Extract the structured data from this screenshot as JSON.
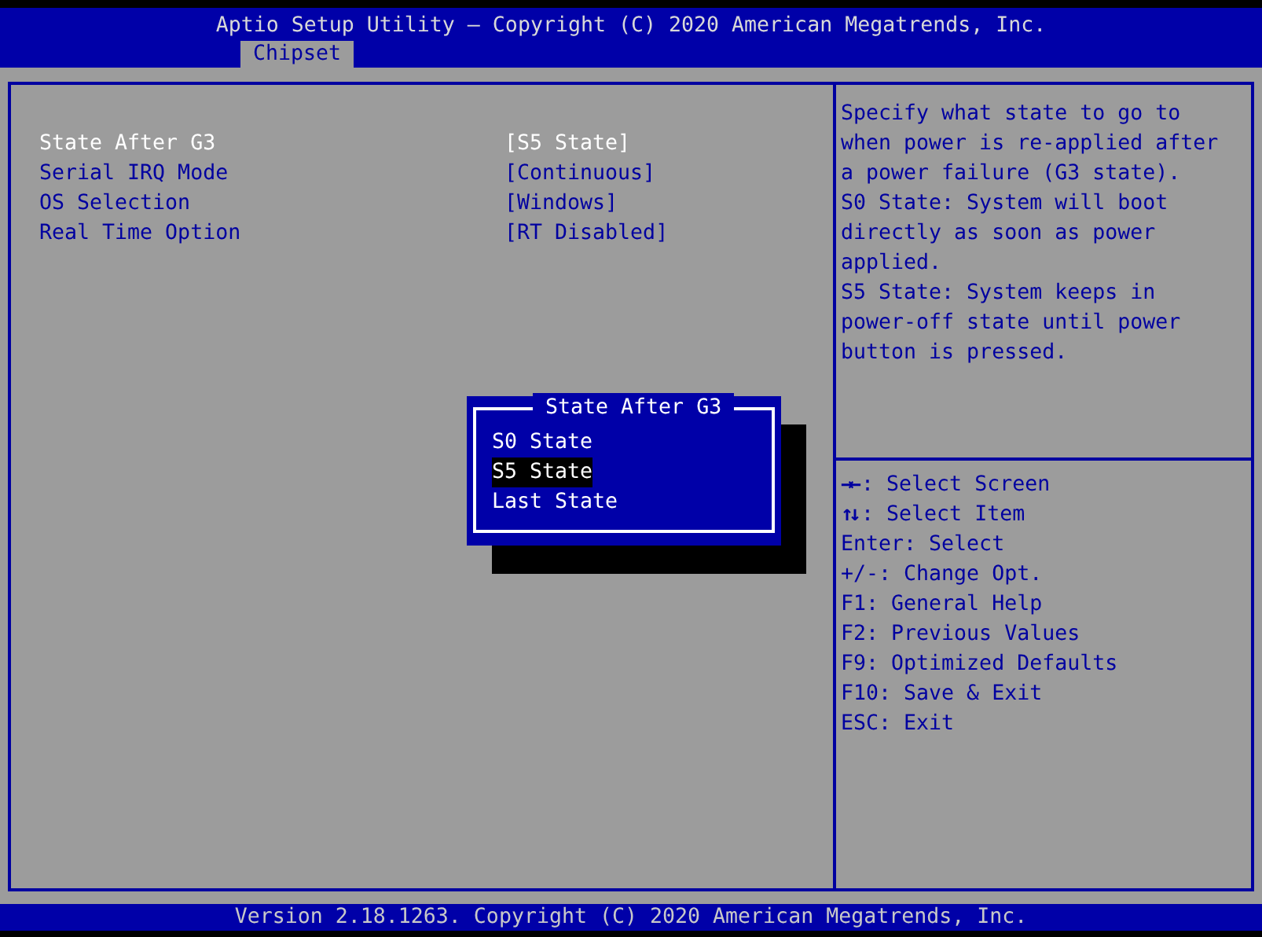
{
  "header": {
    "title": "Aptio Setup Utility – Copyright (C) 2020 American Megatrends, Inc."
  },
  "tabs": [
    {
      "label": "Chipset",
      "selected": true
    }
  ],
  "settings": [
    {
      "label": "State After G3",
      "value": "[S5 State]",
      "selected": true
    },
    {
      "label": "Serial IRQ Mode",
      "value": "[Continuous]",
      "selected": false
    },
    {
      "label": "OS Selection",
      "value": "[Windows]",
      "selected": false
    },
    {
      "label": "Real Time Option",
      "value": "[RT Disabled]",
      "selected": false
    }
  ],
  "help_text": [
    "Specify what state to go to when power is re-applied after a power failure (G3 state).",
    "S0 State: System will boot directly as soon as power applied.",
    "S5 State: System keeps in power-off state until power button is pressed."
  ],
  "key_legend": [
    {
      "key": "→←",
      "action": ": Select Screen"
    },
    {
      "key": "↑↓",
      "action": ": Select Item"
    },
    {
      "action": "Enter: Select"
    },
    {
      "action": "+/-: Change Opt."
    },
    {
      "action": "F1: General Help"
    },
    {
      "action": "F2: Previous Values"
    },
    {
      "action": "F9: Optimized Defaults"
    },
    {
      "action": "F10: Save & Exit"
    },
    {
      "action": "ESC: Exit"
    }
  ],
  "popup": {
    "title": "State After G3",
    "options": [
      {
        "label": "S0 State",
        "selected": false
      },
      {
        "label": "S5 State",
        "selected": true
      },
      {
        "label": "Last State",
        "selected": false
      }
    ]
  },
  "footer": {
    "text": "Version 2.18.1263. Copyright (C) 2020 American Megatrends, Inc."
  }
}
